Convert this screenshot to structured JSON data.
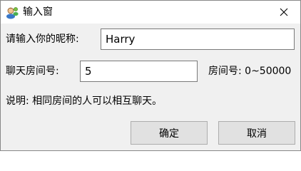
{
  "window": {
    "title": "输入窗",
    "icon": "user-icon",
    "close_icon": "close-icon"
  },
  "form": {
    "nickname_label": "请输入你的昵称:",
    "nickname_value": "Harry",
    "room_label": "聊天房间号:",
    "room_value": "5",
    "room_hint": "房间号: 0~50000",
    "description": "说明: 相同房间的人可以相互聊天。"
  },
  "buttons": {
    "ok_label": "确定",
    "cancel_label": "取消"
  }
}
